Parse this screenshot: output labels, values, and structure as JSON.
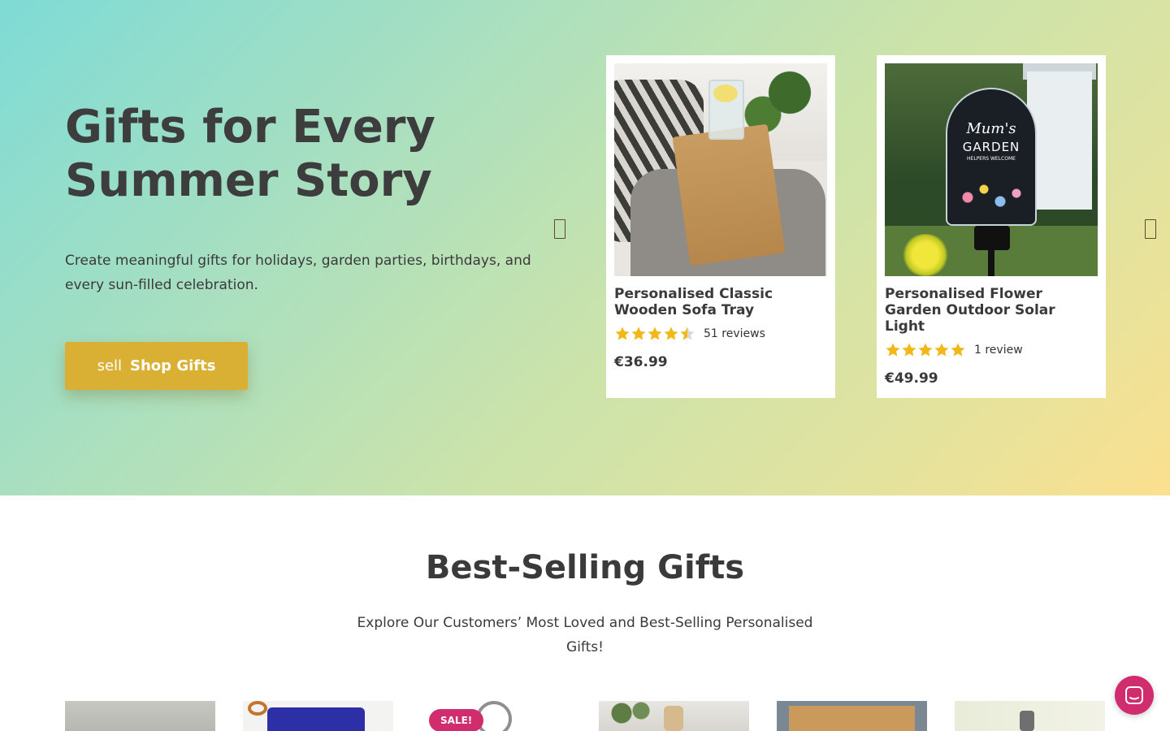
{
  "hero": {
    "title": "Gifts for Every Summer Story",
    "subtitle": "Create meaningful gifts for holidays, garden parties, birthdays, and every sun-filled celebration.",
    "button": {
      "icon_text": "sell",
      "label": "Shop Gifts"
    },
    "carousel": {
      "products": [
        {
          "title": "Personalised Classic Wooden Sofa Tray",
          "rating": 4.5,
          "reviews": "51 reviews",
          "price": "€36.99"
        },
        {
          "title": "Personalised Flower Garden Outdoor Solar Light",
          "rating": 5,
          "reviews": "1 review",
          "price": "€49.99",
          "image_text": {
            "line1": "Mum's",
            "line2": "GARDEN",
            "line3": "HELPERS WELCOME"
          }
        }
      ]
    }
  },
  "bestsellers": {
    "title": "Best-Selling Gifts",
    "subtitle": "Explore Our Customers’ Most Loved and Best-Selling Personalised Gifts!",
    "sale_badge": "SALE!"
  },
  "colors": {
    "accent_button": "#d9b033",
    "sale_badge": "#d02c6e",
    "chat_button": "#d02c6e",
    "star": "#f2b817"
  },
  "icons": {
    "carousel_prev": "chevron-left-icon",
    "carousel_next": "chevron-right-icon",
    "chat": "chat-icon"
  }
}
